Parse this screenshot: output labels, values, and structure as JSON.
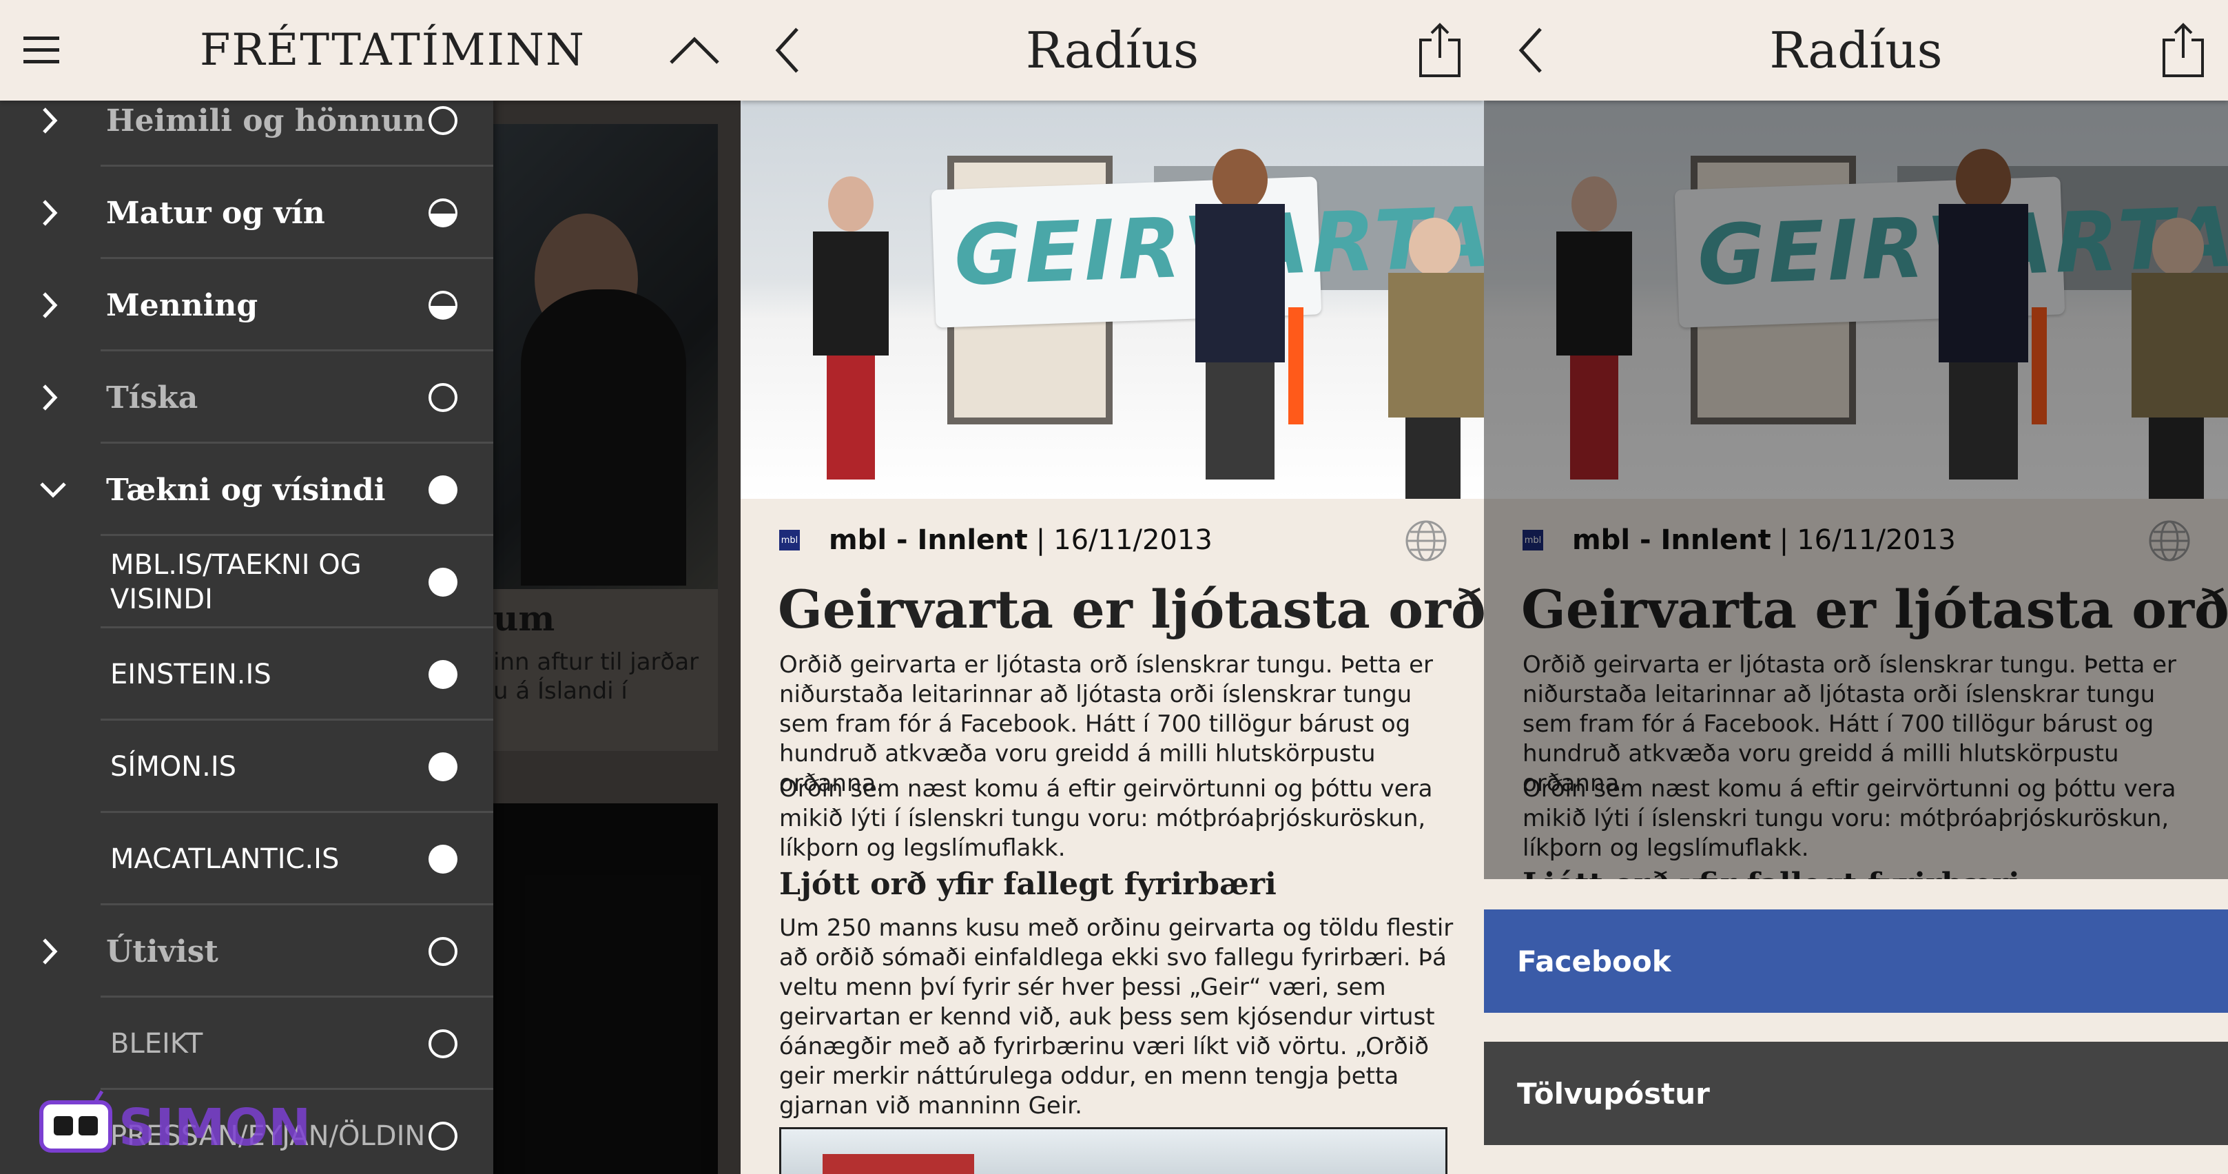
{
  "screen1": {
    "app_title": "FRÉTTATÍMINN",
    "news_heading_fragment": "um",
    "news_text_fragment": "inn aftur til jarðar u á Íslandi í",
    "categories": [
      {
        "label": "Heimili og hönnun",
        "state": "empty",
        "expanded": false,
        "dimmed": true
      },
      {
        "label": "Matur og vín",
        "state": "half",
        "expanded": false,
        "dimmed": false
      },
      {
        "label": "Menning",
        "state": "half",
        "expanded": false,
        "dimmed": false
      },
      {
        "label": "Tíska",
        "state": "empty",
        "expanded": false,
        "dimmed": true
      },
      {
        "label": "Tækni og vísindi",
        "state": "full",
        "expanded": true,
        "dimmed": false
      },
      {
        "label": "MBL.IS/TAEKNI OG VISINDI",
        "state": "full",
        "sub": true
      },
      {
        "label": "EINSTEIN.IS",
        "state": "full",
        "sub": true
      },
      {
        "label": "SÍMON.IS",
        "state": "full",
        "sub": true
      },
      {
        "label": "MACATLANTIC.IS",
        "state": "full",
        "sub": true
      },
      {
        "label": "Útivist",
        "state": "empty",
        "expanded": false,
        "dimmed": true
      },
      {
        "label": "BLEIKT",
        "state": "empty",
        "sub": true,
        "dimmed": true
      },
      {
        "label": "PRESSAN/EYJAN/ÖLDIN",
        "state": "empty",
        "sub": true,
        "dimmed": true
      }
    ],
    "logo_text": "SIMON"
  },
  "article": {
    "app_title": "Radíus",
    "banner_text": "GEIRVARTA",
    "source_badge": "mbl",
    "source": "mbl - Innlent",
    "separator": "|",
    "date": "16/11/2013",
    "headline": "Geirvarta er ljótasta orðið",
    "p1": "Orðið geirvarta er ljótasta orð íslenskrar tungu. Þetta er niðurstaða leitarinnar að ljótasta orði íslenskrar tungu sem fram fór á Facebook. Hátt í 700 tillögur bárust og hundruð atkvæða voru greidd á milli hlutskörpustu orðanna.",
    "p2": "Orðin sem næst komu á eftir geirvörtunni og þóttu vera mikið lýti í íslenskri tungu voru: mótþróaþrjóskuröskun, líkþorn og legslímuflakk.",
    "subhead": "Ljótt orð yfir fallegt fyrirbæri",
    "p3": "Um 250 manns kusu með orðinu geirvarta og töldu flestir að orðið sómaði einfaldlega ekki svo fallegu fyrirbæri. Þá veltu menn því fyrir sér hver þessi „Geir“ væri, sem geirvartan er kennd við, auk þess sem kjósendur virtust óánægðir með að fyrirbærinu væri líkt við vörtu. „Orðið geir merkir náttúrulega oddur, en menn tengja þetta gjarnan við manninn Geir."
  },
  "share_sheet": {
    "facebook_label": "Facebook",
    "email_label": "Tölvupóstur"
  },
  "colors": {
    "topbar_bg": "#f3ece5",
    "drawer_bg": "#363636",
    "article_bg": "#f2ebe3",
    "facebook_blue": "#3a5ba8",
    "email_gray": "#444444",
    "logo_purple": "#7b3fd1"
  },
  "icons": {
    "menu": "hamburger-icon",
    "collapse": "chevron-up-icon",
    "back": "chevron-left-icon",
    "share": "share-icon",
    "web": "globe-icon",
    "expand": "chevron-right-icon",
    "expanded": "chevron-down-icon"
  }
}
